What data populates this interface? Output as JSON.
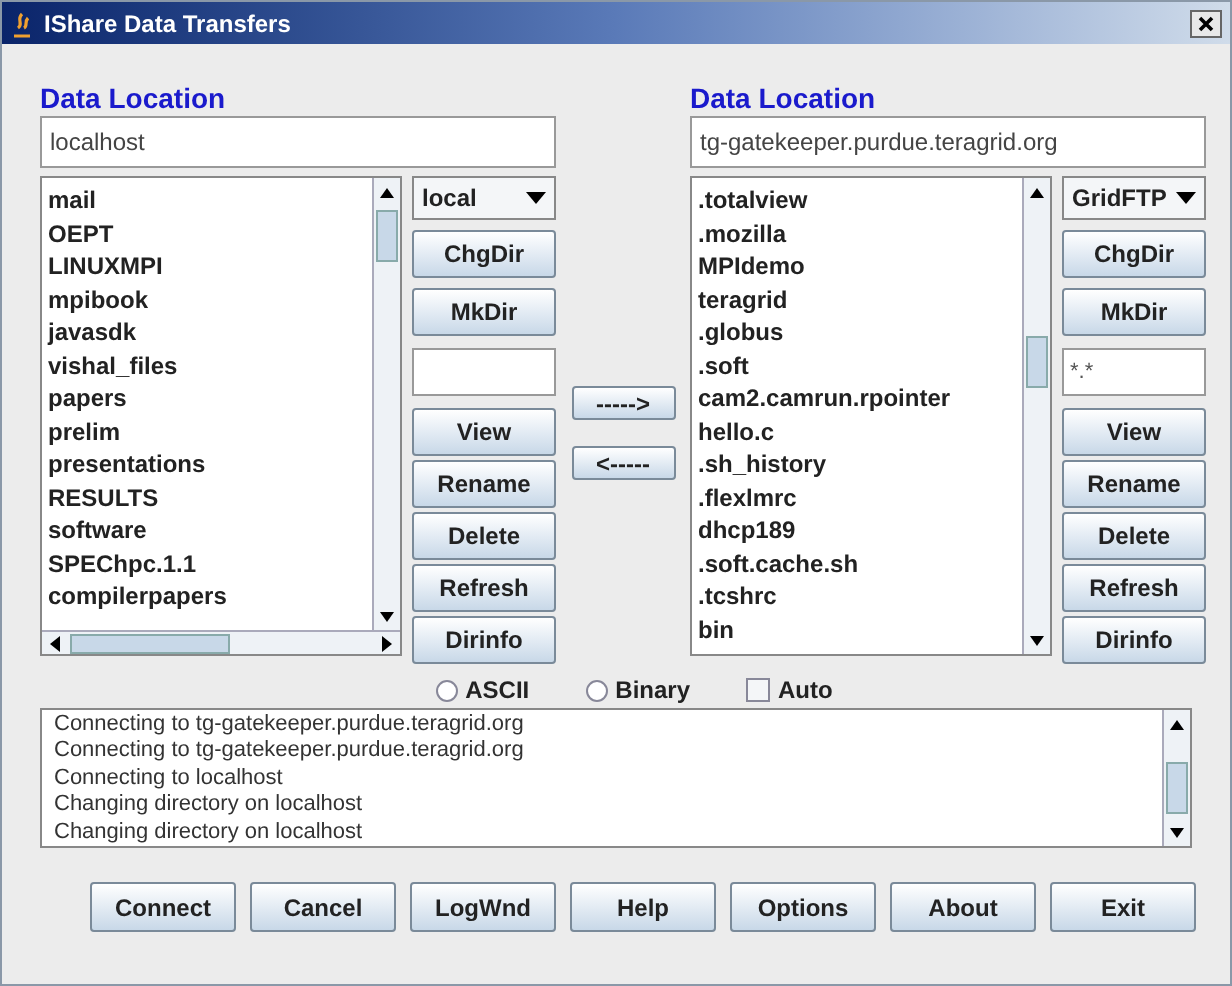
{
  "window": {
    "title": "IShare Data Transfers"
  },
  "panels": [
    {
      "heading": "Data Location",
      "host": "localhost",
      "protocol": "local",
      "files": [
        "mail",
        "OEPT",
        "LINUXMPI",
        "mpibook",
        "javasdk",
        "vishal_files",
        "papers",
        "prelim",
        "presentations",
        "RESULTS",
        "software",
        "SPEChpc.1.1",
        "compilerpapers"
      ],
      "buttons": [
        "ChgDir",
        "MkDir",
        "View",
        "Rename",
        "Delete",
        "Refresh",
        "Dirinfo"
      ]
    },
    {
      "heading": "Data Location",
      "host": "tg-gatekeeper.purdue.teragrid.org",
      "protocol": "GridFTP",
      "filter": "*.*",
      "files": [
        ".totalview",
        ".mozilla",
        "MPIdemo",
        "teragrid",
        ".globus",
        ".soft",
        "cam2.camrun.rpointer",
        "hello.c",
        ".sh_history",
        ".flexlmrc",
        "dhcp189",
        ".soft.cache.sh",
        ".tcshrc",
        "bin"
      ],
      "buttons": [
        "ChgDir",
        "MkDir",
        "View",
        "Rename",
        "Delete",
        "Refresh",
        "Dirinfo"
      ]
    }
  ],
  "transfer_buttons": [
    "----->",
    "<-----"
  ],
  "modes": [
    {
      "kind": "radio",
      "label": "ASCII",
      "selected": false
    },
    {
      "kind": "radio",
      "label": "Binary",
      "selected": false
    },
    {
      "kind": "checkbox",
      "label": "Auto",
      "checked": false
    }
  ],
  "log": [
    "Connecting to tg-gatekeeper.purdue.teragrid.org",
    "Connecting to tg-gatekeeper.purdue.teragrid.org",
    "Connecting to localhost",
    "Changing directory on localhost",
    "Changing directory on localhost"
  ],
  "buttons": [
    "Connect",
    "Cancel",
    "LogWnd",
    "Help",
    "Options",
    "About",
    "Exit"
  ]
}
